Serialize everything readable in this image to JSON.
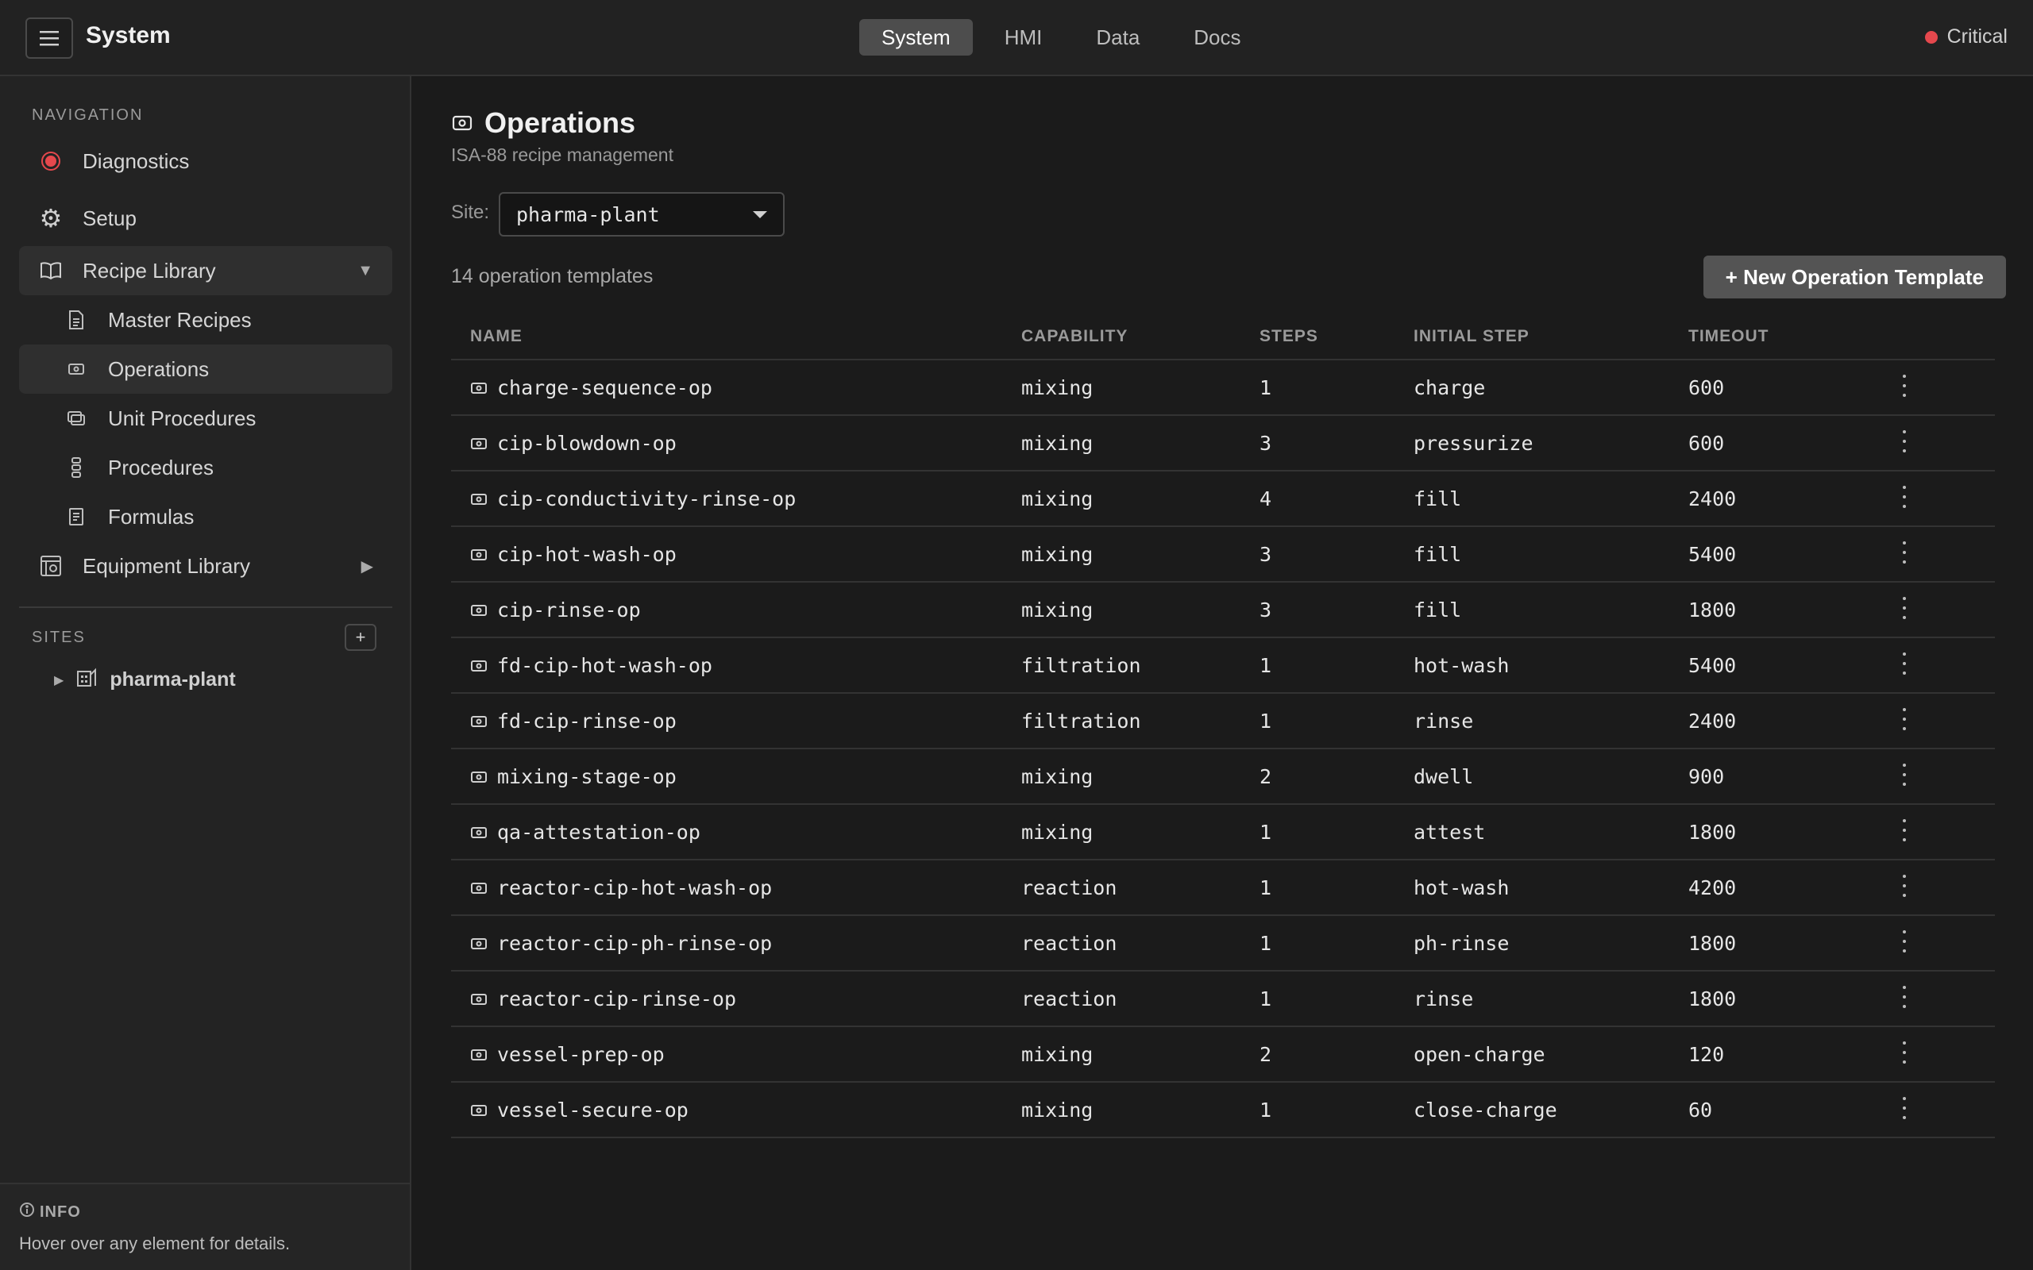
{
  "header": {
    "title": "System",
    "tabs": [
      {
        "label": "System",
        "active": true
      },
      {
        "label": "HMI",
        "active": false
      },
      {
        "label": "Data",
        "active": false
      },
      {
        "label": "Docs",
        "active": false
      }
    ],
    "status": {
      "label": "Critical",
      "color": "#e5484d"
    }
  },
  "sidebar": {
    "nav_label": "NAVIGATION",
    "items": [
      {
        "label": "Diagnostics",
        "icon": "alert-dot-icon"
      },
      {
        "label": "Setup",
        "icon": "gear-icon"
      },
      {
        "label": "Recipe Library",
        "icon": "book-icon",
        "expanded": true
      },
      {
        "label": "Master Recipes",
        "icon": "document-icon"
      },
      {
        "label": "Operations",
        "icon": "operation-icon",
        "selected": true
      },
      {
        "label": "Unit Procedures",
        "icon": "stack-icon"
      },
      {
        "label": "Procedures",
        "icon": "chain-icon"
      },
      {
        "label": "Formulas",
        "icon": "formula-icon"
      },
      {
        "label": "Equipment Library",
        "icon": "equipment-icon",
        "expanded": false
      }
    ],
    "sites_label": "SITES",
    "add_site": "+",
    "sites": [
      {
        "name": "pharma-plant"
      }
    ],
    "info": {
      "title": "INFO",
      "text": "Hover over any element for details."
    }
  },
  "main": {
    "title": "Operations",
    "subtitle": "ISA-88 recipe management",
    "site_label": "Site:",
    "site_value": "pharma-plant",
    "count_text": "14 operation templates",
    "new_button": "+ New Operation Template",
    "columns": [
      "NAME",
      "CAPABILITY",
      "STEPS",
      "INITIAL STEP",
      "TIMEOUT"
    ],
    "rows": [
      {
        "name": "charge-sequence-op",
        "capability": "mixing",
        "steps": "1",
        "initial_step": "charge",
        "timeout": "600"
      },
      {
        "name": "cip-blowdown-op",
        "capability": "mixing",
        "steps": "3",
        "initial_step": "pressurize",
        "timeout": "600"
      },
      {
        "name": "cip-conductivity-rinse-op",
        "capability": "mixing",
        "steps": "4",
        "initial_step": "fill",
        "timeout": "2400"
      },
      {
        "name": "cip-hot-wash-op",
        "capability": "mixing",
        "steps": "3",
        "initial_step": "fill",
        "timeout": "5400"
      },
      {
        "name": "cip-rinse-op",
        "capability": "mixing",
        "steps": "3",
        "initial_step": "fill",
        "timeout": "1800"
      },
      {
        "name": "fd-cip-hot-wash-op",
        "capability": "filtration",
        "steps": "1",
        "initial_step": "hot-wash",
        "timeout": "5400"
      },
      {
        "name": "fd-cip-rinse-op",
        "capability": "filtration",
        "steps": "1",
        "initial_step": "rinse",
        "timeout": "2400"
      },
      {
        "name": "mixing-stage-op",
        "capability": "mixing",
        "steps": "2",
        "initial_step": "dwell",
        "timeout": "900"
      },
      {
        "name": "qa-attestation-op",
        "capability": "mixing",
        "steps": "1",
        "initial_step": "attest",
        "timeout": "1800"
      },
      {
        "name": "reactor-cip-hot-wash-op",
        "capability": "reaction",
        "steps": "1",
        "initial_step": "hot-wash",
        "timeout": "4200"
      },
      {
        "name": "reactor-cip-ph-rinse-op",
        "capability": "reaction",
        "steps": "1",
        "initial_step": "ph-rinse",
        "timeout": "1800"
      },
      {
        "name": "reactor-cip-rinse-op",
        "capability": "reaction",
        "steps": "1",
        "initial_step": "rinse",
        "timeout": "1800"
      },
      {
        "name": "vessel-prep-op",
        "capability": "mixing",
        "steps": "2",
        "initial_step": "open-charge",
        "timeout": "120"
      },
      {
        "name": "vessel-secure-op",
        "capability": "mixing",
        "steps": "1",
        "initial_step": "close-charge",
        "timeout": "60"
      }
    ]
  }
}
